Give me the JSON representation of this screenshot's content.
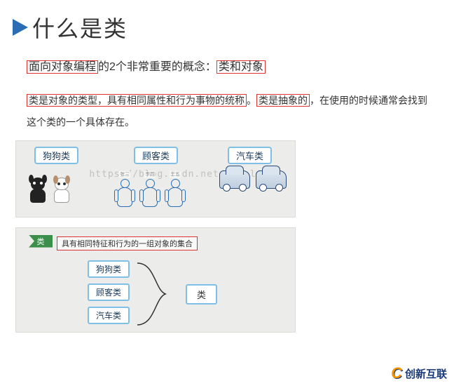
{
  "heading": {
    "title": "什么是类"
  },
  "para1": {
    "seg1": "面向对象编程",
    "seg2": "的2个非常重要的概念：",
    "seg3": "类和对象"
  },
  "para2": {
    "seg1": "类是对象的类型，具有相同属性和行为事物的统称",
    "seg2": "。",
    "seg3": "类是抽象的",
    "seg4": "，在使用的时候通常会找到这个类的一个具体存在。"
  },
  "panel1": {
    "tags": {
      "dog": "狗狗类",
      "cust": "顾客类",
      "car": "汽车类"
    },
    "people": {
      "p1": "张三",
      "p2": "李四",
      "p3": "王五"
    },
    "watermark": "https://blog.csdn.net/loveliuzz"
  },
  "panel2": {
    "flag": "类",
    "desc": "具有相同特征和行为的一组对象的集合",
    "cats": {
      "dog": "狗狗类",
      "cust": "顾客类",
      "car": "汽车类"
    },
    "class_label": "类"
  },
  "footer": {
    "logo_c": "C",
    "logo_text": "创新互联"
  }
}
